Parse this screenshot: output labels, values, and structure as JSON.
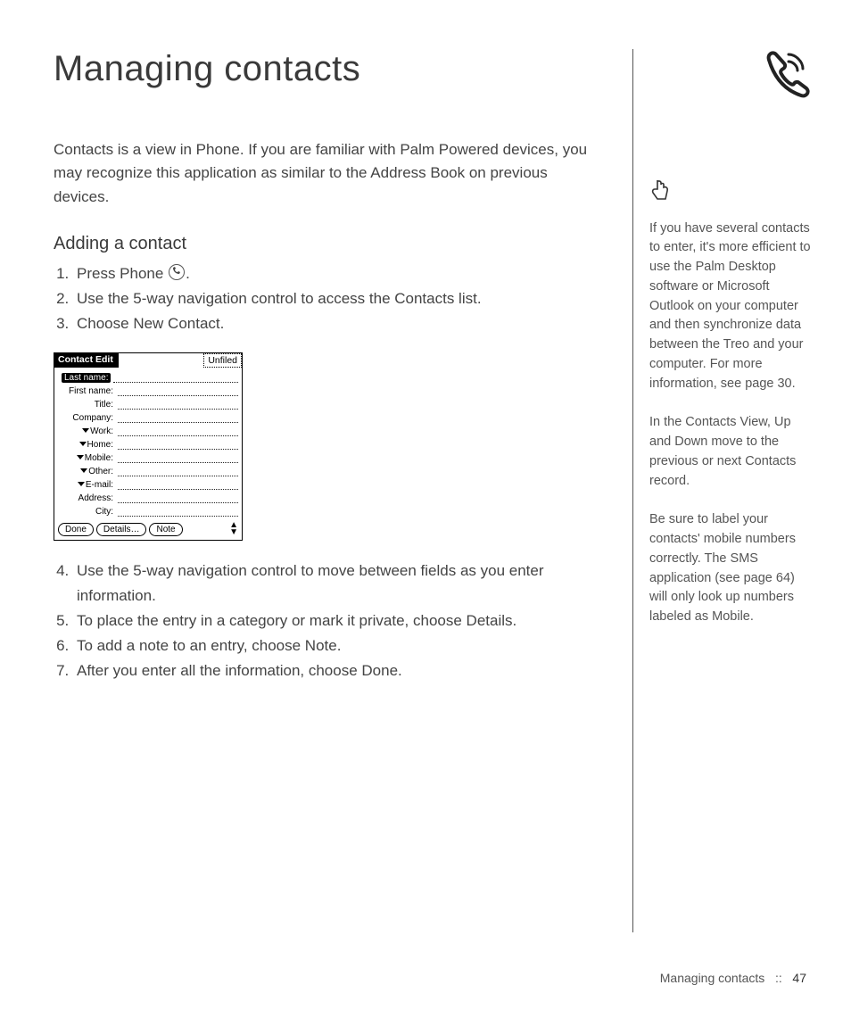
{
  "title": "Managing contacts",
  "intro": "Contacts is a view in Phone. If you are familiar with Palm Powered devices, you may recognize this application as similar to the Address Book on previous devices.",
  "section_heading": "Adding a contact",
  "steps_a": {
    "s1_pre": "Press Phone ",
    "s1_post": ".",
    "s2": "Use the 5-way navigation control to access the Contacts list.",
    "s3": "Choose New Contact."
  },
  "steps_b": {
    "s4": "Use the 5-way navigation control to move between fields as you enter information.",
    "s5": "To place the entry in a category or mark it private, choose Details.",
    "s6": "To add a note to an entry, choose Note.",
    "s7": "After you enter all the information, choose Done."
  },
  "palm": {
    "title": "Contact Edit",
    "category": "Unfiled",
    "fields": {
      "lastname": "Last name:",
      "firstname": "First name:",
      "titlef": "Title:",
      "company": "Company:",
      "work": "Work:",
      "home": "Home:",
      "mobile": "Mobile:",
      "other": "Other:",
      "email": "E-mail:",
      "address": "Address:",
      "city": "City:"
    },
    "buttons": {
      "done": "Done",
      "details": "Details…",
      "note": "Note"
    }
  },
  "tips": {
    "t1": "If you have several contacts to enter, it's more efficient to use the Palm Desktop software or Microsoft Outlook on your computer and then synchronize data between the Treo and your computer. For more information, see page 30.",
    "t2": "In the Contacts View, Up and Down move to the previous or next Contacts record.",
    "t3": "Be sure to label your contacts' mobile numbers correctly. The SMS application (see page 64) will only look up numbers labeled as Mobile."
  },
  "footer": {
    "section": "Managing contacts",
    "sep": "::",
    "page": "47"
  }
}
